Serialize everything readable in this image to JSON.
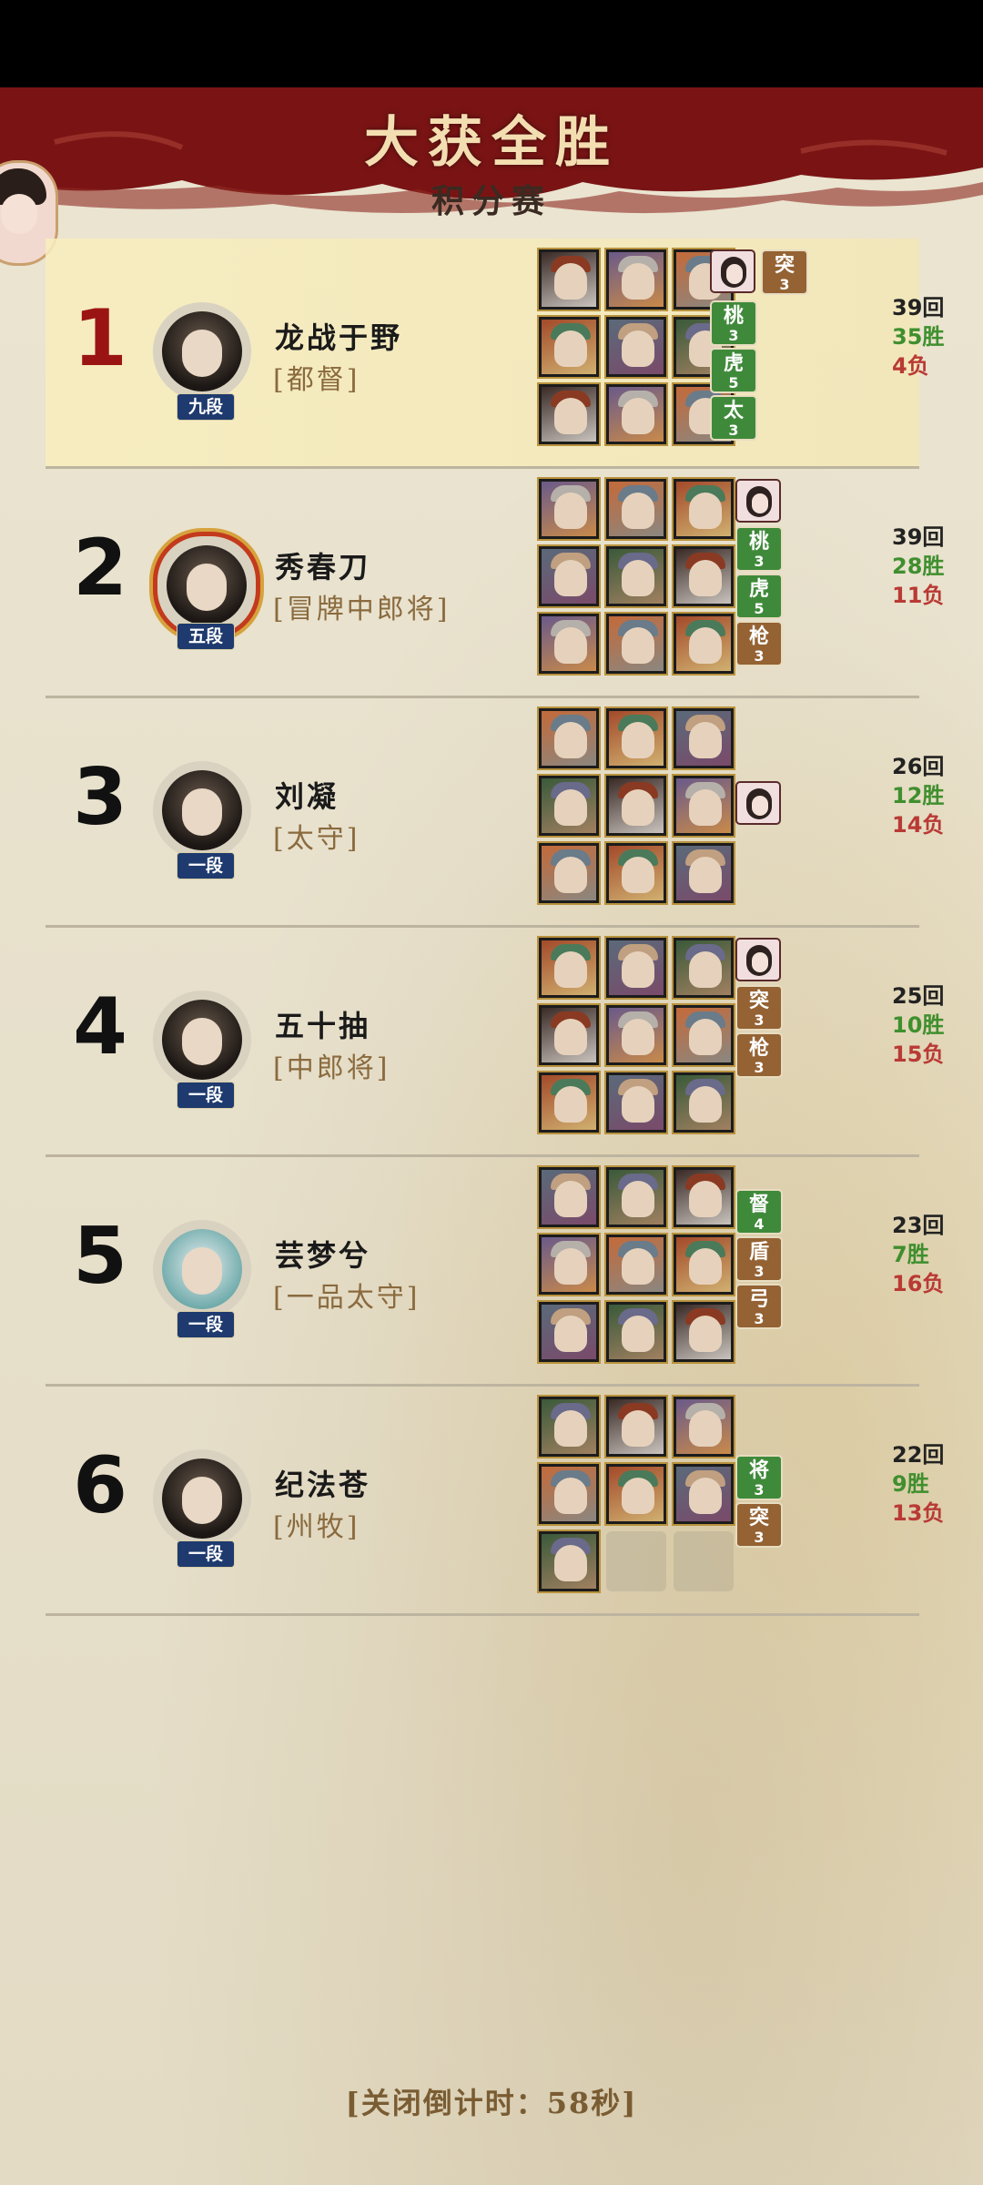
{
  "header": {
    "title": "大获全胜",
    "subtitle": "积分赛"
  },
  "colors": {
    "banner": "#7a1414",
    "rank_first": "#9b1414",
    "win": "#3f8f2e",
    "loss": "#b93a35",
    "tag_green": "#3f8a3a",
    "tag_brown": "#946233",
    "rank_badge": "#1e3a6e"
  },
  "players": [
    {
      "rank": "1",
      "name": "龙战于野",
      "title": "[都督]",
      "dan": "九段",
      "rounds": "39回",
      "wins": "35胜",
      "losses": "4负",
      "heroes": 9,
      "tags": [
        {
          "type": "portrait"
        },
        {
          "type": "brown",
          "label": "突",
          "num": "3"
        },
        {
          "type": "green",
          "label": "桃",
          "num": "3"
        },
        {
          "type": "green",
          "label": "虎",
          "num": "5"
        },
        {
          "type": "green",
          "label": "太",
          "num": "3"
        }
      ]
    },
    {
      "rank": "2",
      "name": "秀春刀",
      "title": "[冒牌中郎将]",
      "dan": "五段",
      "rounds": "39回",
      "wins": "28胜",
      "losses": "11负",
      "heroes": 9,
      "tags": [
        {
          "type": "portrait"
        },
        {
          "type": "green",
          "label": "桃",
          "num": "3"
        },
        {
          "type": "green",
          "label": "虎",
          "num": "5"
        },
        {
          "type": "brown",
          "label": "枪",
          "num": "3"
        }
      ]
    },
    {
      "rank": "3",
      "name": "刘凝",
      "title": "[太守]",
      "dan": "一段",
      "rounds": "26回",
      "wins": "12胜",
      "losses": "14负",
      "heroes": 9,
      "tags": [
        {
          "type": "portrait"
        }
      ]
    },
    {
      "rank": "4",
      "name": "五十抽",
      "title": "[中郎将]",
      "dan": "一段",
      "rounds": "25回",
      "wins": "10胜",
      "losses": "15负",
      "heroes": 9,
      "tags": [
        {
          "type": "portrait"
        },
        {
          "type": "brown",
          "label": "突",
          "num": "3"
        },
        {
          "type": "brown",
          "label": "枪",
          "num": "3"
        }
      ]
    },
    {
      "rank": "5",
      "name": "芸梦兮",
      "title": "[一品太守]",
      "dan": "一段",
      "rounds": "23回",
      "wins": "7胜",
      "losses": "16负",
      "heroes": 9,
      "tags": [
        {
          "type": "green",
          "label": "督",
          "num": "4"
        },
        {
          "type": "brown",
          "label": "盾",
          "num": "3"
        },
        {
          "type": "brown",
          "label": "弓",
          "num": "3"
        }
      ]
    },
    {
      "rank": "6",
      "name": "纪法苍",
      "title": "[州牧]",
      "dan": "一段",
      "rounds": "22回",
      "wins": "9胜",
      "losses": "13负",
      "heroes": 7,
      "tags": [
        {
          "type": "green",
          "label": "将",
          "num": "3"
        },
        {
          "type": "brown",
          "label": "突",
          "num": "3"
        }
      ]
    }
  ],
  "footer": {
    "countdown": "[关闭倒计时：58秒]"
  }
}
